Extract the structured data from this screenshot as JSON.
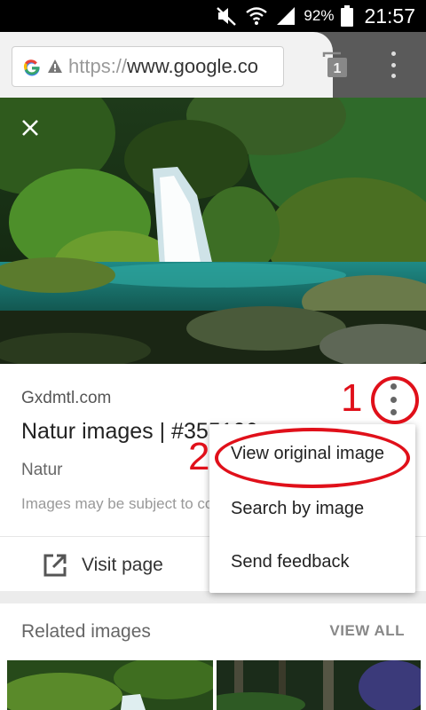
{
  "status_bar": {
    "battery_percent": "92%",
    "time": "21:57",
    "icons": [
      "mute-icon",
      "wifi-icon",
      "signal-icon",
      "battery-icon"
    ]
  },
  "browser": {
    "url_scheme": "https://",
    "url_host": "www.google.co",
    "tab_count": "1",
    "icons": [
      "google-g-icon",
      "warning-icon",
      "tabs-icon",
      "menu-icon"
    ]
  },
  "viewer": {
    "icons": [
      "close-icon",
      "more-vert-icon",
      "open-in-new-icon"
    ]
  },
  "result": {
    "source": "Gxdmtl.com",
    "title": "Natur images | #355106",
    "category": "Natur",
    "disclaimer": "Images may be subject to copyright.",
    "visit_label": "Visit page"
  },
  "related": {
    "title": "Related images",
    "view_all": "VIEW ALL"
  },
  "menu": {
    "items": [
      "View original image",
      "Search by image",
      "Send feedback"
    ]
  },
  "annotations": {
    "step1": "1",
    "step2": "2"
  },
  "colors": {
    "annotation_red": "#e0101a",
    "toolbar_dark": "#5a5a5a"
  }
}
